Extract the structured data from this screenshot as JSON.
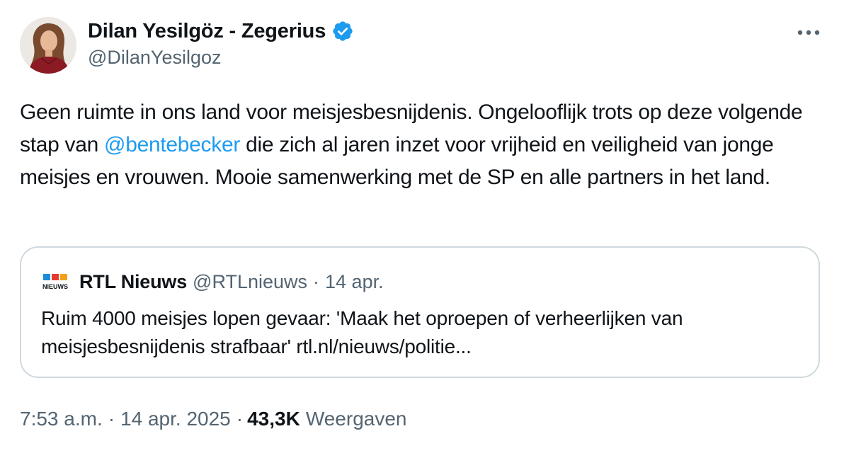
{
  "author": {
    "name": "Dilan Yesilgöz - Zegerius",
    "handle": "@DilanYesilgoz",
    "verified": true
  },
  "tweet": {
    "text_before_mention": "Geen ruimte in ons land voor meisjesbesnijdenis. Ongelooflijk trots op deze volgende stap van ",
    "mention": "@bentebecker",
    "text_after_mention": " die zich al jaren inzet voor vrijheid en veiligheid van jonge meisjes en vrouwen. Mooie samenwerking met de SP en alle partners in het land."
  },
  "quoted_tweet": {
    "logo_text": "NIEUWS",
    "author_name": "RTL Nieuws",
    "handle": "@RTLnieuws",
    "separator": "·",
    "date": "14 apr.",
    "text": "Ruim 4000 meisjes lopen gevaar: 'Maak het oproepen of verheerlijken van meisjesbesnijdenis strafbaar' rtl.nl/nieuws/politie..."
  },
  "footer": {
    "time": "7:53 a.m.",
    "date": "14 apr. 2025",
    "separator": "·",
    "views_count": "43,3K",
    "views_label": "Weergaven"
  },
  "colors": {
    "accent": "#1d9bf0",
    "text": "#0f1419",
    "secondary": "#536471",
    "border": "#cfd9de"
  },
  "icons": {
    "verified": "verified-badge-icon",
    "more": "more-options-icon",
    "quote_logo": "rtl-nieuws-logo"
  }
}
